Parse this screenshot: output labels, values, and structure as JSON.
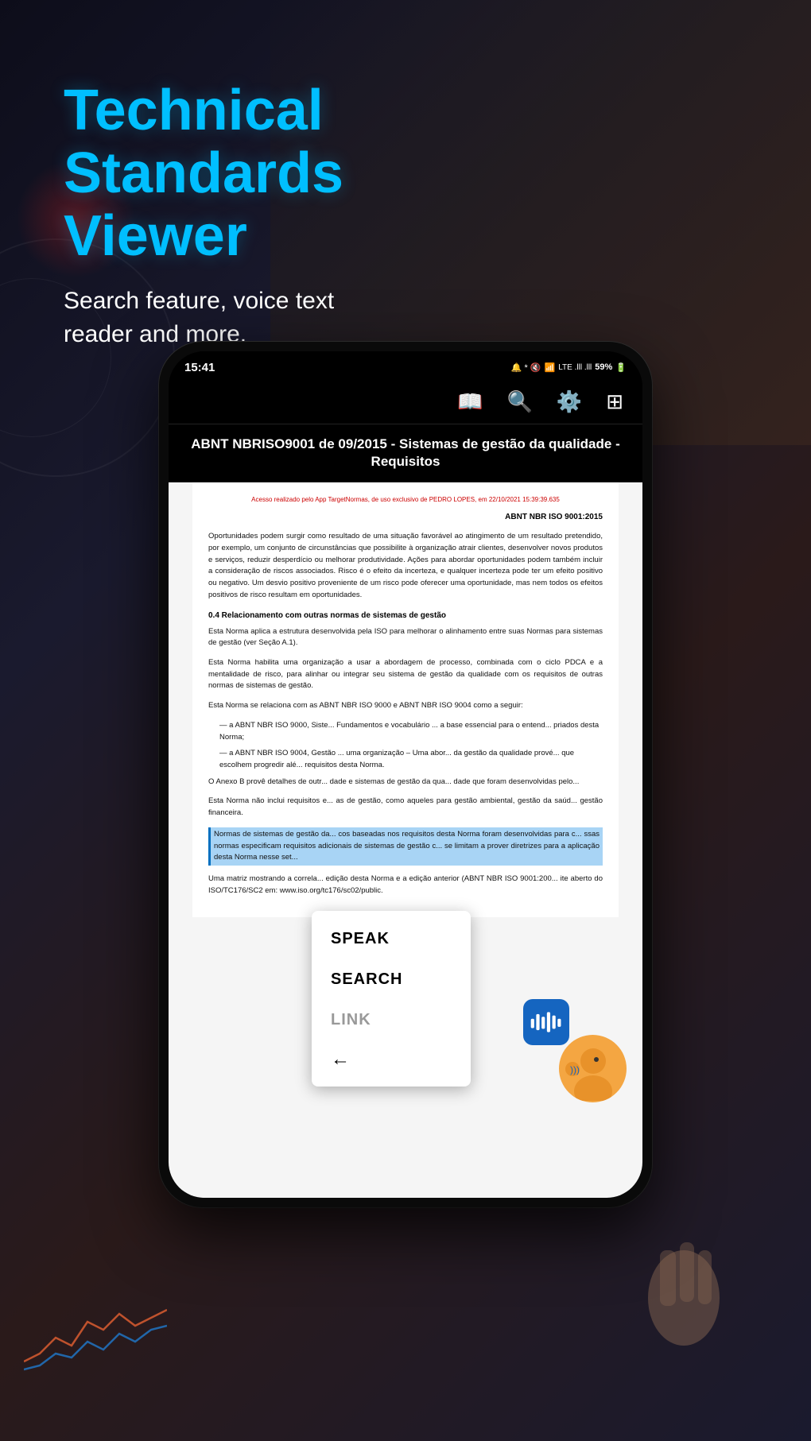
{
  "background": {
    "color_primary": "#0d0d1a",
    "color_secondary": "#1a1a2e"
  },
  "header": {
    "title_line1": "Technical",
    "title_line2": "Standards",
    "title_line3": "Viewer",
    "subtitle": "Search feature, voice text reader and more."
  },
  "status_bar": {
    "time": "15:41",
    "battery": "59%",
    "signal_text": "VoLTE"
  },
  "toolbar": {
    "icons": [
      "book-icon",
      "search-icon",
      "settings-icon",
      "grid-icon"
    ]
  },
  "document": {
    "title": "ABNT NBRISO9001 de 09/2015 - Sistemas de gestão da qualidade - Requisitos",
    "header_watermark": "Acesso realizado pelo App TargetNormas, de uso exclusivo de PEDRO LOPES, em 22/10/2021 15:39:39.635",
    "norm_reference": "ABNT NBR ISO 9001:2015",
    "paragraph1": "Oportunidades podem surgir como resultado de uma situação favorável ao atingimento de um resultado pretendido, por exemplo, um conjunto de circunstâncias que possibilite à organização atrair clientes, desenvolver novos produtos e serviços, reduzir desperdício ou melhorar produtividade. Ações para abordar oportunidades podem também incluir a consideração de riscos associados. Risco é o efeito da incerteza, e qualquer incerteza pode ter um efeito positivo ou negativo. Um desvio positivo proveniente de um risco pode oferecer uma oportunidade, mas nem todos os efeitos positivos de risco resultam em oportunidades.",
    "section_title": "0.4   Relacionamento com outras normas de sistemas de gestão",
    "paragraph2": "Esta Norma aplica a estrutura desenvolvida pela ISO para melhorar o alinhamento entre suas Normas para sistemas de gestão (ver Seção A.1).",
    "paragraph3": "Esta Norma habilita uma organização a usar a abordagem de processo, combinada com o ciclo PDCA e a mentalidade de risco, para alinhar ou integrar seu sistema de gestão da qualidade com os requisitos de outras normas de sistemas de gestão.",
    "paragraph4": "Esta Norma se relaciona com as ABNT NBR ISO 9000 e ABNT NBR ISO 9004 como a seguir:",
    "bullet1": "— a ABNT NBR ISO 9000, Siste... Fundamentos e vocabulário ... a base essencial para o entend... priados desta Norma;",
    "bullet2": "— a ABNT NBR ISO 9004, Gestão ... uma organização – Uma abor... da gestão da qualidade prové... que escolhem progredir alé... requisitos desta Norma.",
    "paragraph5": "O Anexo B provê detalhes de outr... dade e sistemas de gestão da qua... dade que foram desenvolvidas pelo...",
    "paragraph6": "Esta Norma não inclui requisitos e... as de gestão, como aqueles para gestão ambiental, gestão da saúd... gestão financeira.",
    "paragraph_highlighted": "Normas de sistemas de gestão da... cos baseadas nos requisitos desta Norma foram desenvolvidas para c... ssas normas especificam requisitos adicionais de sistemas de gestão c... se limitam a prover diretrizes para a aplicação desta Norma nesse set...",
    "paragraph7": "Uma matriz mostrando a correla... edição desta Norma e a edição anterior (ABNT NBR ISO 9001:200... ite aberto do ISO/TC176/SC2 em: www.iso.org/tc176/sc02/public."
  },
  "context_menu": {
    "speak_label": "SPEAK",
    "search_label": "SEARCH",
    "link_label": "LINK",
    "back_label": "←"
  },
  "mascot": {
    "wave_bars": [
      20,
      35,
      28,
      40,
      25,
      32,
      18
    ],
    "face_emoji": "🗣"
  }
}
